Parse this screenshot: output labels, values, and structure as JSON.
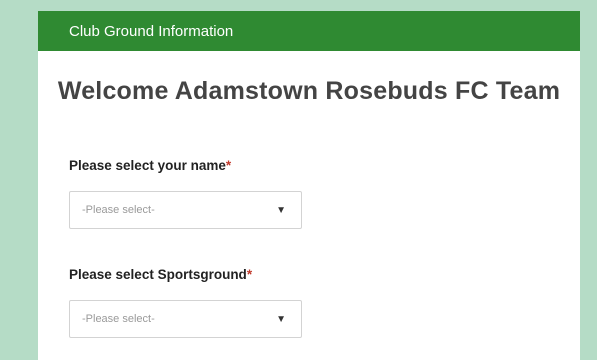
{
  "header": {
    "title": "Club Ground Information"
  },
  "welcome": "Welcome Adamstown Rosebuds FC Team",
  "fields": [
    {
      "label": "Please select your name",
      "required": "*",
      "placeholder": "-Please select-"
    },
    {
      "label": "Please select Sportsground",
      "required": "*",
      "placeholder": "-Please select-"
    }
  ],
  "colors": {
    "background": "#b5dcc6",
    "header": "#2f8a32",
    "required": "#c0392b"
  },
  "icons": {
    "dropdown": "chevron-down-icon"
  }
}
